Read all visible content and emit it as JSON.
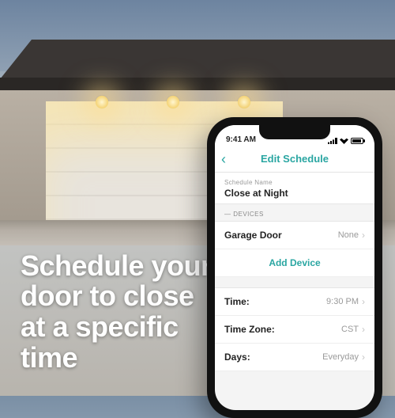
{
  "marketing": {
    "tagline": "Schedule your door to close at a specific time"
  },
  "statusbar": {
    "time": "9:41 AM"
  },
  "nav": {
    "title": "Edit Schedule"
  },
  "schedule": {
    "name_label": "Schedule Name",
    "name_value": "Close at Night"
  },
  "devices": {
    "header": "DEVICES",
    "items": [
      {
        "name": "Garage Door",
        "value": "None"
      }
    ],
    "add_label": "Add Device"
  },
  "settings": [
    {
      "key": "Time:",
      "value": "9:30 PM"
    },
    {
      "key": "Time Zone:",
      "value": "CST"
    },
    {
      "key": "Days:",
      "value": "Everyday"
    }
  ]
}
